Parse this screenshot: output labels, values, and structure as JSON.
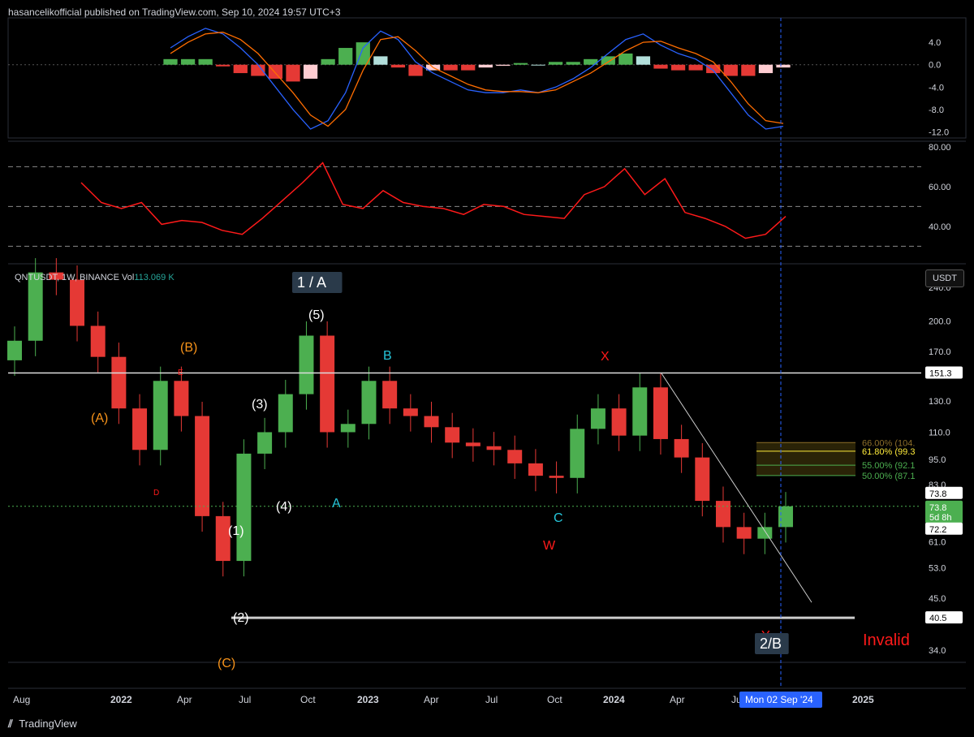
{
  "header": {
    "publisher_text": "hasancelikofficial published on TradingView.com, Sep 10, 2024 19:57 UTC+3"
  },
  "symbol": {
    "name_text": "QNTUSDT, 1W, BINANCE",
    "vol_label": "Vol",
    "vol_value": "113.069 K"
  },
  "currency_label": "USDT",
  "footer": {
    "brand": "TradingView"
  },
  "colors": {
    "up": "#4caf50",
    "down": "#e53935",
    "macd_fast": "#2962ff",
    "macd_signal": "#ff6d00",
    "rsi": "#ff1a1a",
    "orange": "#f7931a",
    "cyan": "#26c6da",
    "yellow": "#ffeb3b",
    "red": "#ff1a1a",
    "white": "#ffffff"
  },
  "chart_data": [
    {
      "type": "line",
      "pane": "macd",
      "y_ticks": [
        "4.0",
        "0.0",
        "-4.0",
        "-8.0",
        "-12.0"
      ],
      "y_tick_values": [
        4,
        0,
        -4,
        -8,
        -12
      ],
      "ylim": [
        -12.8,
        7.5
      ],
      "x": [
        "2021-10",
        "2021-11",
        "2021-12",
        "2022-01",
        "2022-02",
        "2022-03",
        "2022-04",
        "2022-05",
        "2022-06",
        "2022-07",
        "2022-08",
        "2022-09",
        "2022-10",
        "2022-11",
        "2022-12",
        "2023-01",
        "2023-02",
        "2023-03",
        "2023-04",
        "2023-05",
        "2023-06",
        "2023-07",
        "2023-08",
        "2023-09",
        "2023-10",
        "2023-11",
        "2023-12",
        "2024-01",
        "2024-02",
        "2024-03",
        "2024-04",
        "2024-05",
        "2024-06",
        "2024-07",
        "2024-08",
        "2024-09"
      ],
      "series": [],
      "macd_fast": [
        3.0,
        5.0,
        6.5,
        5.5,
        3.0,
        0.0,
        -4.0,
        -8.0,
        -11.5,
        -10.0,
        -5.0,
        3.0,
        6.0,
        4.5,
        0.5,
        -1.5,
        -3.0,
        -4.5,
        -5.0,
        -5.0,
        -4.5,
        -5.0,
        -4.0,
        -2.5,
        -0.5,
        2.0,
        4.5,
        5.5,
        3.5,
        2.0,
        1.0,
        -1.0,
        -5.0,
        -9.0,
        -11.5,
        -11.0
      ],
      "macd_signal": [
        2.0,
        4.0,
        5.5,
        5.8,
        4.5,
        2.0,
        -1.5,
        -5.0,
        -9.0,
        -11.0,
        -8.0,
        -1.0,
        4.5,
        5.0,
        2.5,
        -0.5,
        -2.0,
        -3.5,
        -4.5,
        -4.8,
        -4.8,
        -5.0,
        -4.5,
        -3.0,
        -1.5,
        0.5,
        2.5,
        4.0,
        4.2,
        3.0,
        2.0,
        0.5,
        -3.0,
        -7.0,
        -10.0,
        -10.5
      ],
      "histogram": [
        1.0,
        1.0,
        1.0,
        -0.3,
        -1.5,
        -2.0,
        -2.5,
        -3.0,
        -2.5,
        1.0,
        3.0,
        4.0,
        1.5,
        -0.5,
        -2.0,
        -1.0,
        -1.0,
        -1.0,
        -0.5,
        -0.2,
        0.3,
        0.0,
        0.5,
        0.5,
        1.0,
        1.5,
        2.0,
        1.5,
        -0.7,
        -1.0,
        -1.0,
        -1.5,
        -2.0,
        -2.0,
        -1.5,
        -0.5
      ]
    },
    {
      "type": "line",
      "pane": "rsi",
      "y_ticks": [
        "80.00",
        "60.00",
        "40.00"
      ],
      "y_tick_values": [
        80,
        60,
        40
      ],
      "ylim": [
        22,
        82
      ],
      "bands": [
        70,
        50,
        30
      ],
      "x": [
        "2021-10",
        "2021-11",
        "2021-12",
        "2022-01",
        "2022-02",
        "2022-03",
        "2022-04",
        "2022-05",
        "2022-06",
        "2022-07",
        "2022-08",
        "2022-09",
        "2022-10",
        "2022-11",
        "2022-12",
        "2023-01",
        "2023-02",
        "2023-03",
        "2023-04",
        "2023-05",
        "2023-06",
        "2023-07",
        "2023-08",
        "2023-09",
        "2023-10",
        "2023-11",
        "2023-12",
        "2024-01",
        "2024-02",
        "2024-03",
        "2024-04",
        "2024-05",
        "2024-06",
        "2024-07",
        "2024-08",
        "2024-09"
      ],
      "values": [
        62,
        52,
        49,
        52,
        41,
        43,
        42,
        38,
        36,
        44,
        53,
        62,
        72,
        51,
        49,
        58,
        52,
        50,
        49,
        46,
        51,
        50,
        46,
        45,
        44,
        56,
        60,
        69,
        56,
        64,
        47,
        44,
        40,
        34,
        36,
        45
      ]
    },
    {
      "type": "candlestick",
      "pane": "price",
      "scale": "log",
      "y_ticks": [
        "240.0",
        "200.0",
        "170.0",
        "130.0",
        "110.0",
        "95.0",
        "83.0",
        "61.0",
        "53.0",
        "45.0",
        "34.0"
      ],
      "y_tick_values": [
        240,
        200,
        170,
        130,
        110,
        95,
        83,
        61,
        53,
        45,
        34
      ],
      "ylim": [
        32,
        270
      ],
      "x_ticks": [
        "Aug",
        "2022",
        "Apr",
        "Jul",
        "Oct",
        "2023",
        "Apr",
        "Jul",
        "Oct",
        "2024",
        "Apr",
        "Ju",
        "2025"
      ],
      "crosshair_date": "Mon 02 Sep '24",
      "x": [
        "2021-08",
        "2021-09",
        "2021-10",
        "2021-11",
        "2021-12",
        "2022-01",
        "2022-02",
        "2022-03",
        "2022-04",
        "2022-05",
        "2022-06",
        "2022-07",
        "2022-08",
        "2022-09",
        "2022-10",
        "2022-11",
        "2022-12",
        "2023-01",
        "2023-02",
        "2023-03",
        "2023-04",
        "2023-05",
        "2023-06",
        "2023-07",
        "2023-08",
        "2023-09",
        "2023-10",
        "2023-11",
        "2023-12",
        "2024-01",
        "2024-02",
        "2024-03",
        "2024-04",
        "2024-05",
        "2024-06",
        "2024-07",
        "2024-08",
        "2024-09"
      ],
      "close": [
        180,
        260,
        250,
        195,
        165,
        125,
        100,
        145,
        120,
        70,
        55,
        98,
        110,
        135,
        185,
        110,
        115,
        145,
        125,
        120,
        113,
        104,
        102,
        100,
        93,
        87,
        86,
        112,
        125,
        108,
        140,
        106,
        96,
        76,
        66,
        62,
        66,
        73.8
      ],
      "price_labels": [
        "151.3",
        "73.8",
        "73.8",
        "5d 8h",
        "72.2",
        "40.5"
      ],
      "levels": {
        "resistance": 151.3,
        "invalidation": 40.5,
        "current": 73.8
      },
      "fib_levels": [
        "66.00% (104.",
        "61.80% (99.3",
        "55.00% (92.1",
        "50.00% (87.1"
      ],
      "fib_values": [
        104,
        99.3,
        92.1,
        87.1
      ],
      "annotations": [
        {
          "text": "1 / A",
          "style": "box"
        },
        {
          "text": "(5)"
        },
        {
          "text": "(4)"
        },
        {
          "text": "(3)"
        },
        {
          "text": "(2)"
        },
        {
          "text": "(1)"
        },
        {
          "text": "(A)"
        },
        {
          "text": "(B)"
        },
        {
          "text": "(C)"
        },
        {
          "text": "A"
        },
        {
          "text": "B"
        },
        {
          "text": "C"
        },
        {
          "text": "D"
        },
        {
          "text": "E"
        },
        {
          "text": "W"
        },
        {
          "text": "X"
        },
        {
          "text": "Y"
        },
        {
          "text": "2/B",
          "style": "box"
        },
        {
          "text": "Invalid"
        }
      ]
    }
  ]
}
